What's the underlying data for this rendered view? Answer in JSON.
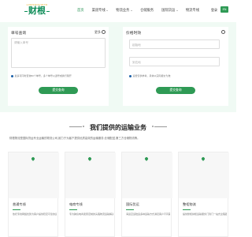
{
  "header": {
    "logo_top": "LOGISTICS WLTO",
    "logo_main": "财根",
    "nav": [
      {
        "label": "首页",
        "active": true,
        "dropdown": false
      },
      {
        "label": "渠道专线",
        "active": false,
        "dropdown": true
      },
      {
        "label": "物流业务",
        "active": false,
        "dropdown": true
      },
      {
        "label": "仓储服务",
        "active": false,
        "dropdown": false
      },
      {
        "label": "国际货运",
        "active": false,
        "dropdown": true
      },
      {
        "label": "物流专线",
        "active": false,
        "dropdown": false
      }
    ],
    "login": "登录",
    "lang": "EN"
  },
  "tracking": {
    "title": "单号查询",
    "more": "更多",
    "placeholder": "请输入单号",
    "note": "最多可同时查询50个单号，多个单号以逗号或换行隔开",
    "submit": "提交查询"
  },
  "quote": {
    "title": "价格时效",
    "origin_placeholder": "起始地",
    "dest_placeholder": "到达地",
    "note": "运费仅供参考，具体以实际报价为准",
    "submit": "提交查询"
  },
  "services": {
    "title": "我们提供的运输业务",
    "intro": "财根物流是国际货运专业运输的物流公司,致力于为客户提供优质高效的运输服务,仓储配送,第三方仓储物流等。",
    "cards": [
      {
        "title": "普通专线",
        "desc": "依托专线网络优势为客户提供稳定可靠的运输方案。"
      },
      {
        "title": "电商专线",
        "desc": "专为跨境电商卖家定制的头程物流运输解决方案。"
      },
      {
        "title": "国际货运",
        "desc": "海运空运陆运多种运输方式满足客户不同需求。"
      },
      {
        "title": "整柜物流",
        "desc": "提供整柜拼柜运输服务门到门一站式全程跟踪。"
      }
    ]
  },
  "colors": {
    "brand": "#2f9a55",
    "hero_bg": "#f0faf4",
    "logo_gold": "#e3a821"
  }
}
